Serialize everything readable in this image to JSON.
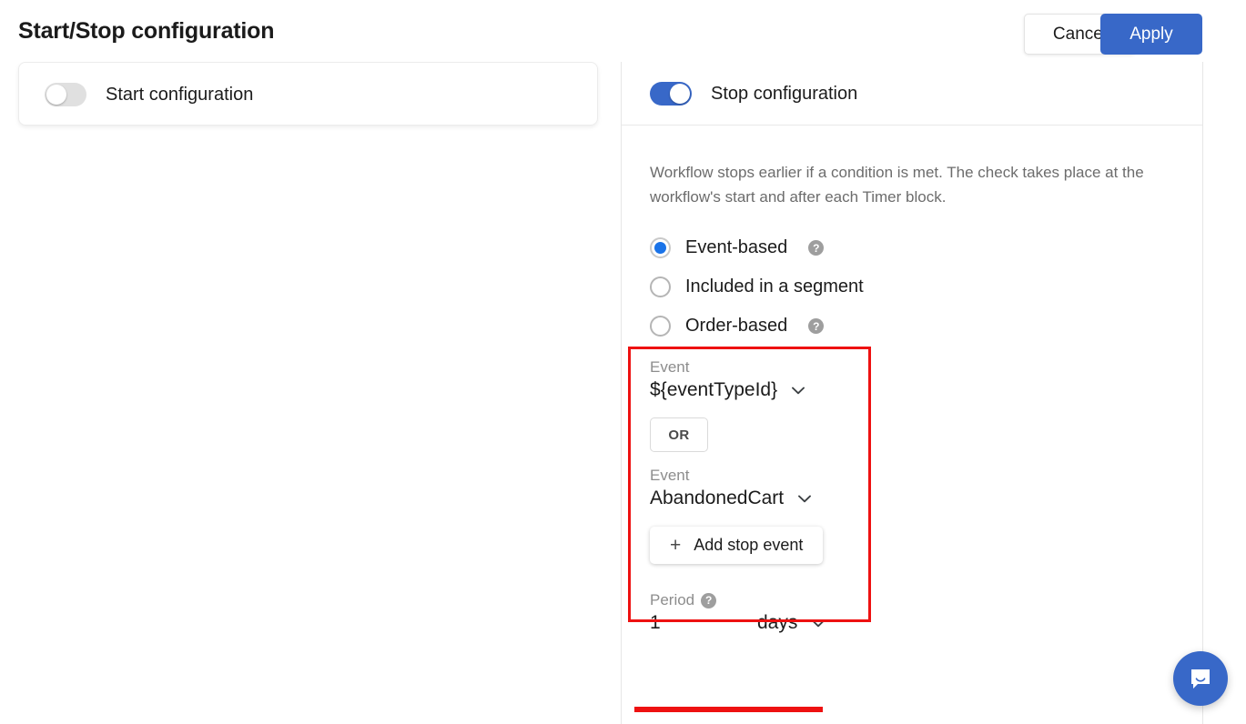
{
  "header": {
    "title": "Start/Stop configuration",
    "cancel_label": "Cancel",
    "apply_label": "Apply"
  },
  "start_panel": {
    "toggle_label": "Start configuration",
    "toggle_state": "off"
  },
  "stop_panel": {
    "toggle_label": "Stop configuration",
    "toggle_state": "on",
    "description": "Workflow stops earlier if a condition is met. The check takes place at the workflow's start and after each Timer block.",
    "radio_options": [
      {
        "label": "Event-based",
        "selected": true,
        "has_help": true
      },
      {
        "label": "Included in a segment",
        "selected": false,
        "has_help": false
      },
      {
        "label": "Order-based",
        "selected": false,
        "has_help": true
      }
    ],
    "event_fields": [
      {
        "label": "Event",
        "value": "${eventTypeId}"
      },
      {
        "label": "Event",
        "value": "AbandonedCart"
      }
    ],
    "or_label": "OR",
    "add_event_label": "Add stop event",
    "add_event_plus": "+",
    "period": {
      "label": "Period",
      "value": "1",
      "unit": "days",
      "has_help": true
    }
  },
  "icons": {
    "help": "?",
    "chevron_down": "chevron-down-icon",
    "chat": "chat-bubble-icon"
  },
  "colors": {
    "accent_blue": "#3868c8",
    "radio_blue": "#1a73e8",
    "annotation_red": "#ee1111",
    "muted_text": "#8d8d8d"
  }
}
